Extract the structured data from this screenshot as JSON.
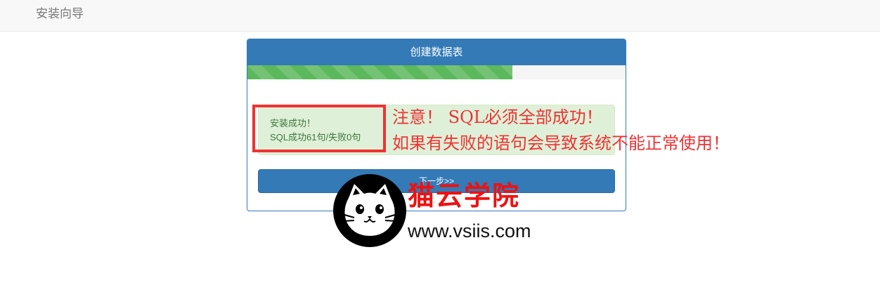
{
  "navbar": {
    "brand": "安装向导"
  },
  "panel": {
    "title": "创建数据表",
    "progress_percent": 70,
    "alert": {
      "line1": "安装成功！",
      "line2": "SQL成功61句/失败0句"
    },
    "next_button": "下一步>>"
  },
  "annotation": {
    "line1": "注意！ SQL必须全部成功！",
    "line2": "如果有失败的语句会导致系统不能正常使用！",
    "color": "#ee3333"
  },
  "watermark": {
    "title": "猫云学院",
    "url": "www.vsiis.com"
  },
  "colors": {
    "primary": "#337ab7",
    "success_bar": "#5cb85c",
    "alert_bg": "#dff0d8",
    "alert_text": "#3c763d"
  }
}
